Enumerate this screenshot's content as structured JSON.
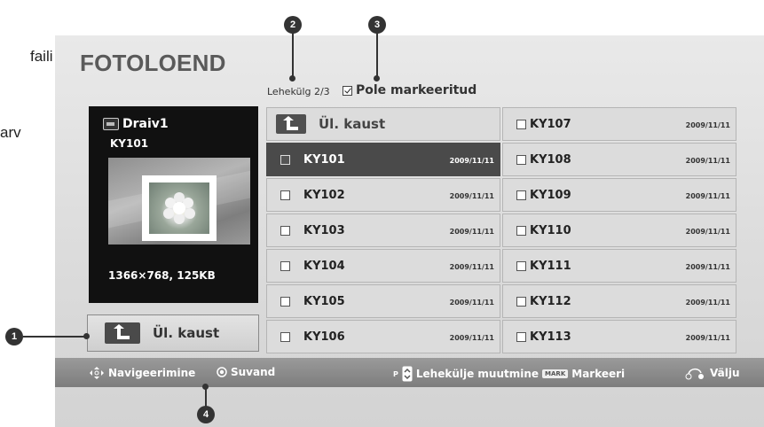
{
  "side_text": [
    "faili",
    "arv"
  ],
  "title": "FOTOLOEND",
  "page_info": "Lehekülg 2/3",
  "mark_status": "Pole markeeritud",
  "preview": {
    "drive": "Draiv1",
    "file_name": "KY101",
    "dimensions": "1366×768, 125KB"
  },
  "up_button": "Ül. kaust",
  "grid_up_dir": "Ül. kaust",
  "files_col1": [
    {
      "name": "KY101",
      "date": "2009/11/11",
      "selected": true
    },
    {
      "name": "KY102",
      "date": "2009/11/11"
    },
    {
      "name": "KY103",
      "date": "2009/11/11"
    },
    {
      "name": "KY104",
      "date": "2009/11/11"
    },
    {
      "name": "KY105",
      "date": "2009/11/11"
    },
    {
      "name": "KY106",
      "date": "2009/11/11"
    }
  ],
  "files_col2": [
    {
      "name": "KY107",
      "date": "2009/11/11"
    },
    {
      "name": "KY108",
      "date": "2009/11/11"
    },
    {
      "name": "KY109",
      "date": "2009/11/11"
    },
    {
      "name": "KY110",
      "date": "2009/11/11"
    },
    {
      "name": "KY111",
      "date": "2009/11/11"
    },
    {
      "name": "KY112",
      "date": "2009/11/11"
    },
    {
      "name": "KY113",
      "date": "2009/11/11"
    }
  ],
  "bottom_bar": {
    "navigate": "Navigeerimine",
    "ok": "Suvand",
    "page_key": "P",
    "page_change": "Lehekülje muutmine",
    "mark_key": "MARK",
    "mark": "Markeeri",
    "exit": "Välju"
  },
  "callouts": [
    "1",
    "2",
    "3",
    "4"
  ],
  "colors": {
    "selected": "#4a4a4a",
    "panel": "#dcdcdc",
    "bar": "#8a8a8a"
  }
}
